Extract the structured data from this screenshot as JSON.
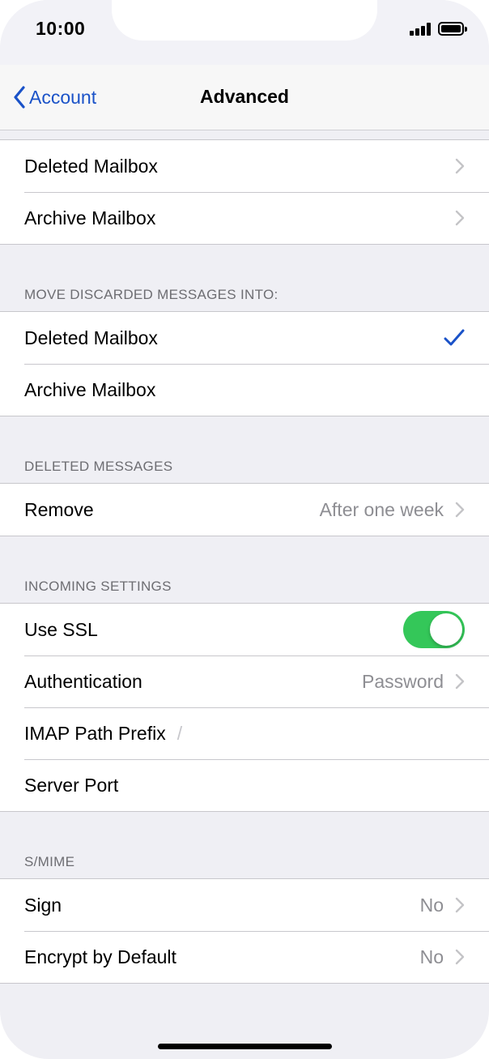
{
  "status_bar": {
    "time": "10:00"
  },
  "nav": {
    "back_label": "Account",
    "title": "Advanced"
  },
  "mailbox_group": {
    "items": [
      {
        "label": "Deleted Mailbox"
      },
      {
        "label": "Archive Mailbox"
      }
    ]
  },
  "discarded": {
    "header": "MOVE DISCARDED MESSAGES INTO:",
    "items": [
      {
        "label": "Deleted Mailbox",
        "selected": true
      },
      {
        "label": "Archive Mailbox",
        "selected": false
      }
    ]
  },
  "deleted_messages": {
    "header": "DELETED MESSAGES",
    "remove": {
      "label": "Remove",
      "value": "After one week"
    }
  },
  "incoming": {
    "header": "INCOMING SETTINGS",
    "use_ssl": {
      "label": "Use SSL",
      "on": true
    },
    "authentication": {
      "label": "Authentication",
      "value": "Password"
    },
    "imap_prefix": {
      "label": "IMAP Path Prefix",
      "value": "/"
    },
    "server_port": {
      "label": "Server Port"
    }
  },
  "smime": {
    "header": "S/MIME",
    "sign": {
      "label": "Sign",
      "value": "No"
    },
    "encrypt": {
      "label": "Encrypt by Default",
      "value": "No"
    }
  },
  "colors": {
    "accent": "#1a52c8",
    "toggle_on": "#34c759",
    "grouped_background": "#efeff4"
  }
}
